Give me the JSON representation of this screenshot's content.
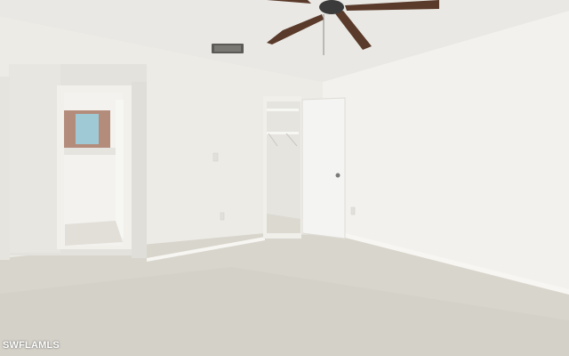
{
  "scene": {
    "description_tokens": [
      "empty-bedroom",
      "ceiling-fan",
      "carpet-floor",
      "open-doorway",
      "walk-in-closet"
    ],
    "colors": {
      "ceiling": "#e9e8e4",
      "wall_left": "#efeeea",
      "wall_right": "#f3f2ee",
      "carpet": "#d8d5cc",
      "baseboard": "#f7f6f2",
      "fan_blade": "#5a3a2a",
      "fan_motor": "#3b3b3b",
      "door": "#f4f4f2",
      "hall_tile": "#e2dfd8"
    }
  },
  "watermark": {
    "text": "SWFLAMLS"
  }
}
